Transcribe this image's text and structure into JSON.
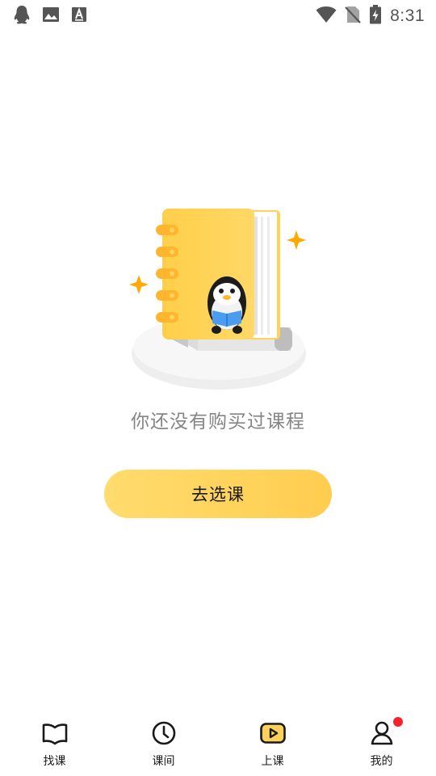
{
  "status_bar": {
    "time": "8:31",
    "left_icons": [
      "qq-penguin-icon",
      "image-icon",
      "font-icon"
    ],
    "right_icons": [
      "wifi-icon",
      "no-sim-icon",
      "battery-charging-icon"
    ]
  },
  "empty_state": {
    "message": "你还没有购买过课程",
    "button_label": "去选课",
    "illustration": "penguin-reading-notebook",
    "accent_color": "#ffd15c"
  },
  "bottom_nav": {
    "items": [
      {
        "label": "找课",
        "icon": "book-open-icon",
        "active": false
      },
      {
        "label": "课间",
        "icon": "clock-icon",
        "active": false
      },
      {
        "label": "上课",
        "icon": "video-play-icon",
        "active": true
      },
      {
        "label": "我的",
        "icon": "user-icon",
        "active": false,
        "has_notification": true
      }
    ],
    "notification_color": "#f5222d"
  }
}
